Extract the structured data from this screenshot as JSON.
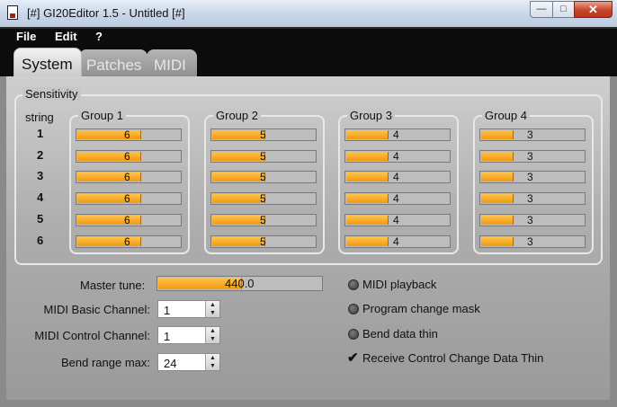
{
  "window": {
    "title": "[#] GI20Editor 1.5 - Untitled [#]",
    "min_glyph": "—",
    "max_glyph": "□",
    "close_glyph": "✕"
  },
  "menu": [
    "File",
    "Edit",
    "?"
  ],
  "tabs": [
    "System",
    "Patches",
    "MIDI"
  ],
  "sensitivity": {
    "title": "Sensitivity",
    "string_header": "string",
    "strings": [
      "1",
      "2",
      "3",
      "4",
      "5",
      "6"
    ],
    "max_value": 10,
    "groups": [
      {
        "name": "Group 1",
        "values": [
          6,
          6,
          6,
          6,
          6,
          6
        ]
      },
      {
        "name": "Group 2",
        "values": [
          5,
          5,
          5,
          5,
          5,
          5
        ]
      },
      {
        "name": "Group 3",
        "values": [
          4,
          4,
          4,
          4,
          4,
          4
        ]
      },
      {
        "name": "Group 4",
        "values": [
          3,
          3,
          3,
          3,
          3,
          3
        ]
      }
    ]
  },
  "master_tune": {
    "label": "Master tune:",
    "value": "440.0",
    "level": 0.5
  },
  "fields": [
    {
      "label": "MIDI Basic Channel:",
      "value": "1"
    },
    {
      "label": "MIDI Control Channel:",
      "value": "1"
    },
    {
      "label": "Bend range max:",
      "value": "24"
    }
  ],
  "options": [
    {
      "label": "MIDI playback",
      "checked": false
    },
    {
      "label": "Program change mask",
      "checked": false
    },
    {
      "label": "Bend data thin",
      "checked": false
    },
    {
      "label": "Receive Control Change Data Thin",
      "checked": true
    }
  ],
  "glyphs": {
    "check": "✔",
    "spin_up": "▲",
    "spin_down": "▼"
  }
}
